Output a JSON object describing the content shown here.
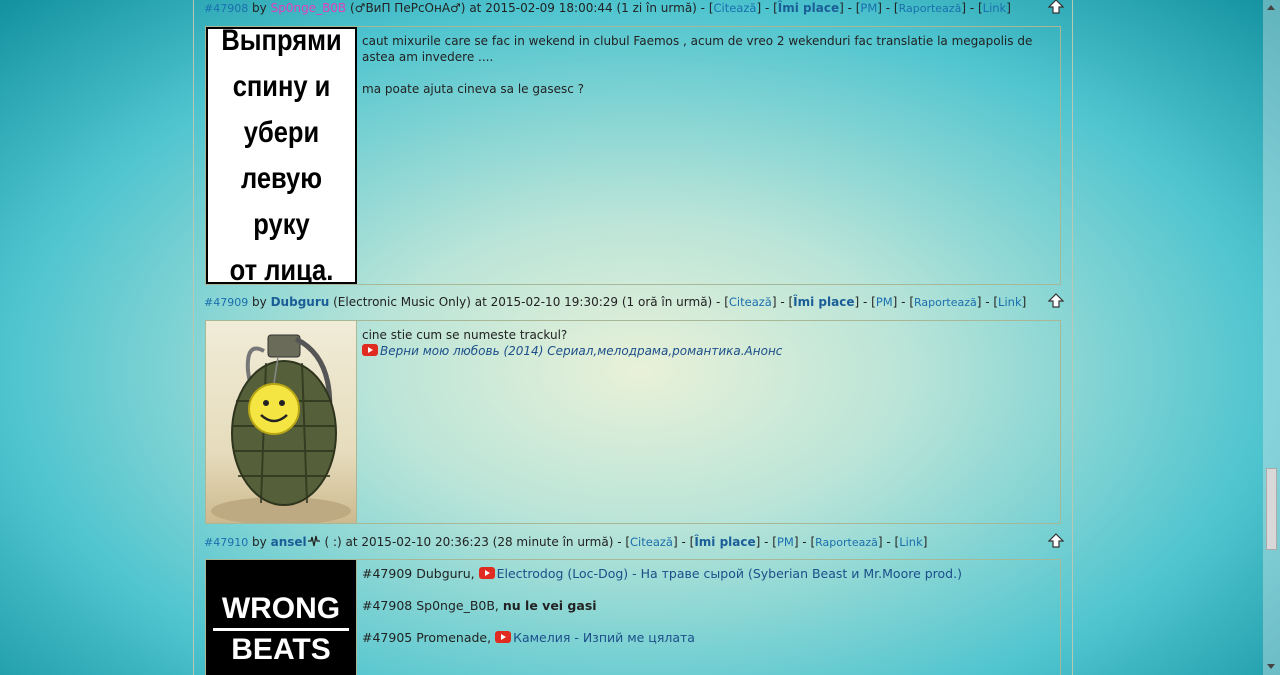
{
  "posts": [
    {
      "number": "#47908",
      "by": "by",
      "username": "Sp0nge_B0B",
      "user_color": "#e040c0",
      "badge": "",
      "status": "(♂ВиП ПеРсОнА♂)",
      "date_text": "at 2015-02-09 18:00:44 (1 zi în urmă) - ",
      "actions": {
        "quote": "Citează",
        "like": "Îmi place",
        "pm": "PM",
        "report": "Raportează",
        "link": "Link"
      },
      "avatar_text": [
        "Выпрями",
        "спину и",
        "убери",
        "левую руку",
        "от лица."
      ],
      "content": {
        "line1": "caut mixurile care se fac in wekend in clubul Faemos , acum de vreo 2 wekenduri fac translatie la megapolis de astea am invedere ....",
        "line2": "ma poate ajuta cineva sa le gasesc ?"
      }
    },
    {
      "number": "#47909",
      "by": "by",
      "username": "Dubguru",
      "user_color": "#1b5e97",
      "status": "(Electronic Music Only)",
      "date_text": "at 2015-02-10 19:30:29 (1 oră în urmă) - ",
      "actions": {
        "quote": "Citează",
        "like": "Îmi place",
        "pm": "PM",
        "report": "Raportează",
        "link": "Link"
      },
      "content": {
        "line1": "cine stie cum se numeste trackul?",
        "video": "Верни мою любовь (2014) Сериал,мелодрама,романтика.Анонс"
      }
    },
    {
      "number": "#47910",
      "by": "by",
      "username": "ansel",
      "user_color": "#1b5e97",
      "status": "( :)",
      "date_text": "at 2015-02-10 20:36:23 (28 minute în urmă) - ",
      "actions": {
        "quote": "Citează",
        "like": "Îmi place",
        "pm": "PM",
        "report": "Raportează",
        "link": "Link"
      },
      "avatar_text": [
        "WRONG",
        "BEATS"
      ],
      "content": {
        "reply1_prefix": "#47909 Dubguru,",
        "reply1_video": "Electrodog (Loc-Dog) - На траве сырой (Syberian Beast и Mr.Moore prod.)",
        "reply2_prefix": "#47908 Sp0nge_B0B,",
        "reply2_text": "nu le vei gasi",
        "reply3_prefix": "#47905 Promenade,",
        "reply3_video": "Камелия - Изпий ме цялата"
      }
    }
  ],
  "ui": {
    "sep_dash": " - "
  }
}
